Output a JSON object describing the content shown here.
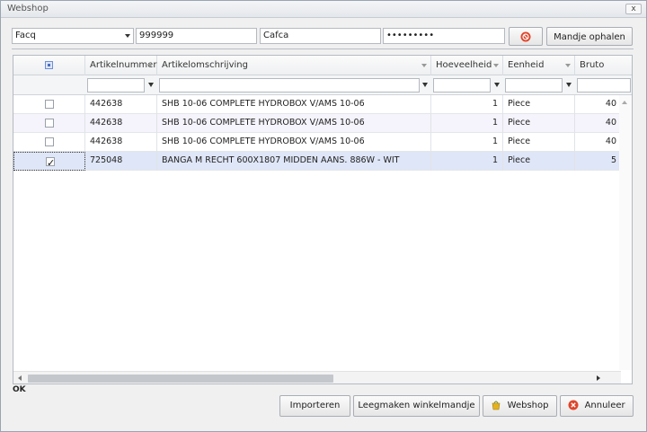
{
  "window": {
    "title": "Webshop",
    "close_label": "x"
  },
  "toolbar": {
    "supplier": "Facq",
    "customer_number": "999999",
    "username": "Cafca",
    "password": "•••••••••",
    "fetch_basket_label": "Mandje ophalen"
  },
  "grid": {
    "columns": [
      "Artikelnummer",
      "Artikelomschrijving",
      "Hoeveelheid",
      "Eenheid",
      "Bruto"
    ],
    "rows": [
      {
        "checked": false,
        "artikelnummer": "442638",
        "omschrijving": "SHB 10-06 COMPLETE HYDROBOX V/AMS 10-06",
        "hoeveelheid": "1",
        "eenheid": "Piece",
        "bruto": "40"
      },
      {
        "checked": false,
        "artikelnummer": "442638",
        "omschrijving": "SHB 10-06 COMPLETE HYDROBOX V/AMS 10-06",
        "hoeveelheid": "1",
        "eenheid": "Piece",
        "bruto": "40"
      },
      {
        "checked": false,
        "artikelnummer": "442638",
        "omschrijving": "SHB 10-06 COMPLETE HYDROBOX V/AMS 10-06",
        "hoeveelheid": "1",
        "eenheid": "Piece",
        "bruto": "40"
      },
      {
        "checked": true,
        "artikelnummer": "725048",
        "omschrijving": "BANGA M RECHT 600X1807 MIDDEN AANS. 886W - WIT",
        "hoeveelheid": "1",
        "eenheid": "Piece",
        "bruto": "5"
      }
    ]
  },
  "status": {
    "text": "OK"
  },
  "footer": {
    "import_label": "Importeren",
    "clear_label": "Leegmaken winkelmandje",
    "webshop_label": "Webshop",
    "cancel_label": "Annuleer"
  },
  "colors": {
    "accent": "#5b7fc7",
    "cancel_icon": "#e0452b",
    "webshop_icon": "#e6b21a"
  }
}
